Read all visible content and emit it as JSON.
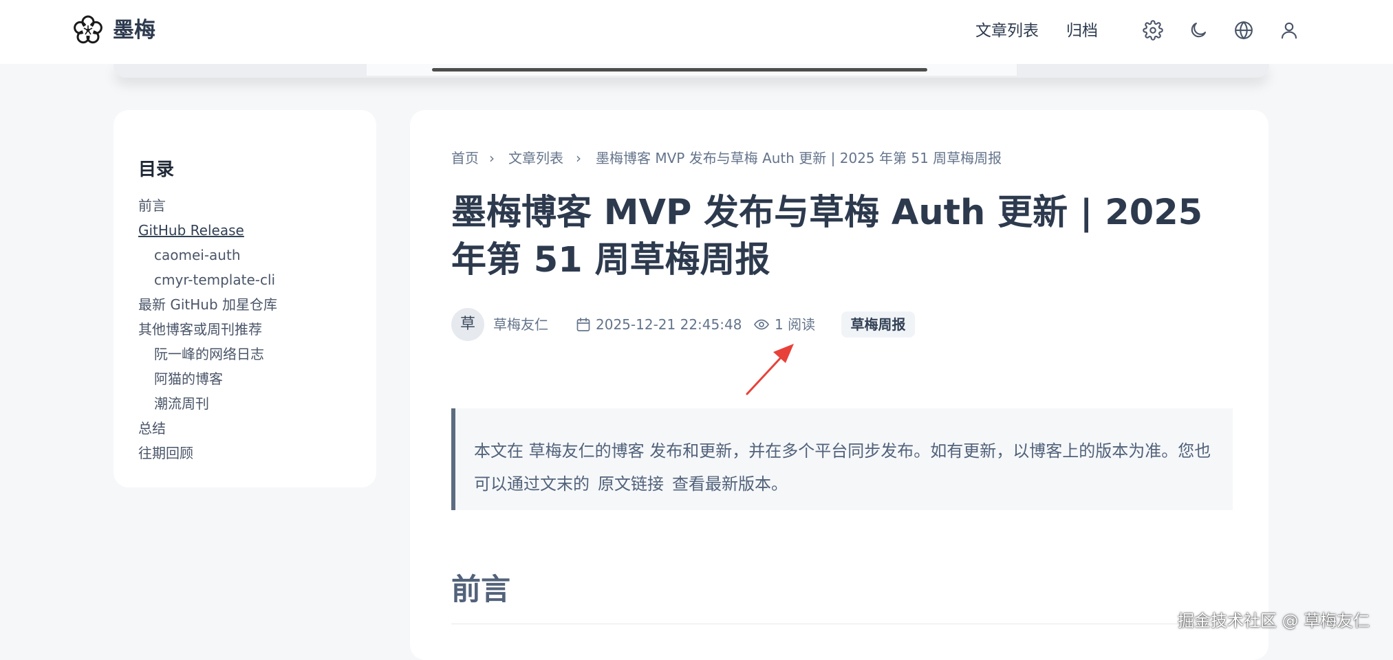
{
  "header": {
    "brand": "墨梅",
    "nav": [
      "文章列表",
      "归档"
    ],
    "icons": [
      "gear-icon",
      "moon-icon",
      "globe-icon",
      "user-icon"
    ]
  },
  "toc": {
    "title": "目录",
    "items": [
      {
        "label": "前言",
        "level": 1
      },
      {
        "label": "GitHub Release",
        "level": 1,
        "active": true
      },
      {
        "label": "caomei-auth",
        "level": 2
      },
      {
        "label": "cmyr-template-cli",
        "level": 2
      },
      {
        "label": "最新 GitHub 加星仓库",
        "level": 1
      },
      {
        "label": "其他博客或周刊推荐",
        "level": 1
      },
      {
        "label": "阮一峰的网络日志",
        "level": 2
      },
      {
        "label": "阿猫的博客",
        "level": 2
      },
      {
        "label": "潮流周刊",
        "level": 2
      },
      {
        "label": "总结",
        "level": 1
      },
      {
        "label": "往期回顾",
        "level": 1
      }
    ]
  },
  "article": {
    "breadcrumb": [
      "首页",
      "文章列表",
      "墨梅博客 MVP 发布与草梅 Auth 更新 | 2025 年第 51 周草梅周报"
    ],
    "breadcrumb_sep": "›",
    "title": "墨梅博客 MVP 发布与草梅 Auth 更新 | 2025 年第 51 周草梅周报",
    "author_avatar": "草",
    "author": "草梅友仁",
    "date": "2025-12-21 22:45:48",
    "views": "1 阅读",
    "tag": "草梅周报",
    "notice_before": "本文在 草梅友仁的博客 发布和更新，并在多个平台同步发布。如有更新，以博客上的版本为准。您也可以通过文末的",
    "notice_link": "原文链接",
    "notice_after": "查看最新版本。",
    "section_heading": "前言"
  },
  "watermark": "掘金技术社区 @ 草梅友仁",
  "colors": {
    "background": "#f6f7f9",
    "heading": "#2d3a4e",
    "muted": "#64748b",
    "quote_border": "#5c6b80",
    "annotation_arrow": "#e8413a"
  }
}
